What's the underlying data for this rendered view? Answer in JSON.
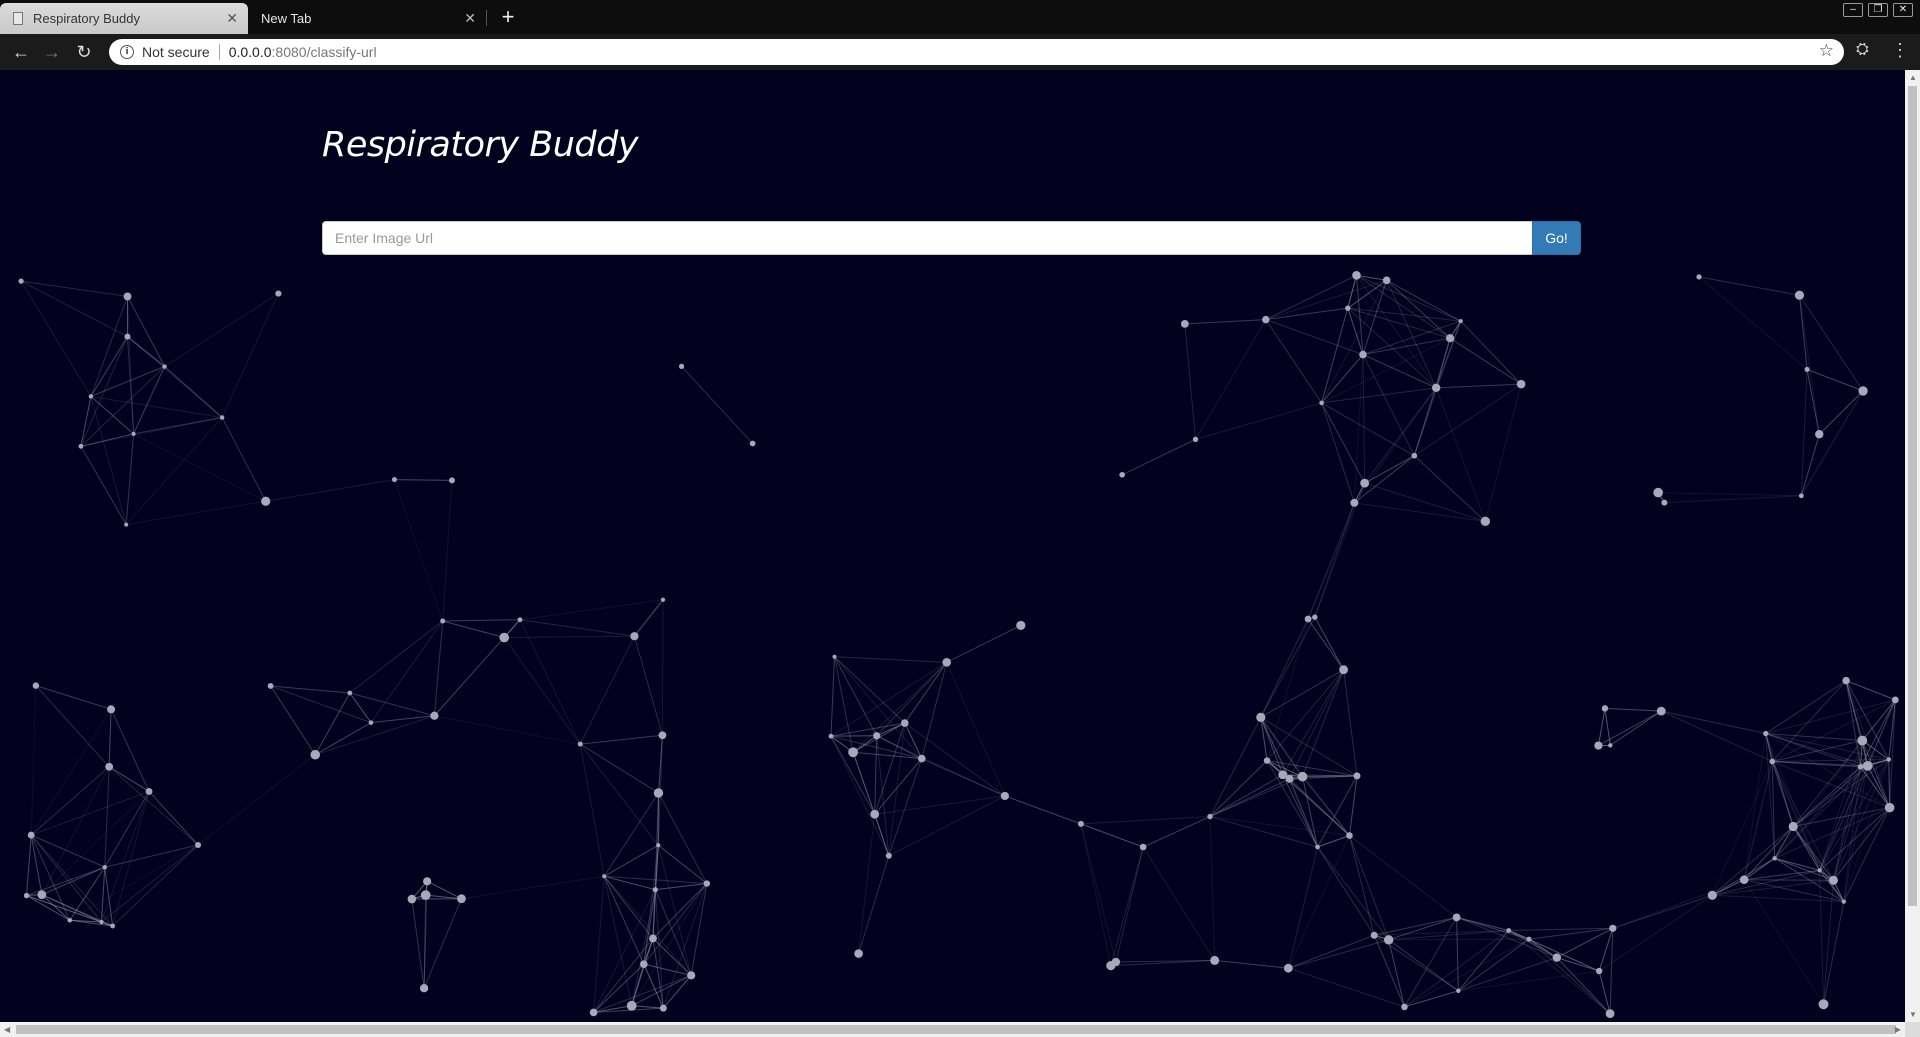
{
  "browser": {
    "tabs": [
      {
        "title": "Respiratory Buddy",
        "active": true
      },
      {
        "title": "New Tab",
        "active": false
      }
    ],
    "security_label": "Not secure",
    "url_host": "0.0.0.0",
    "url_rest": ":8080/classify-url"
  },
  "page": {
    "title": "Respiratory Buddy",
    "search": {
      "placeholder": "Enter Image Url",
      "value": "",
      "button_label": "Go!"
    }
  },
  "colors": {
    "background": "#02021f",
    "particle": "#a8a8b8",
    "button": "#337ab7"
  }
}
